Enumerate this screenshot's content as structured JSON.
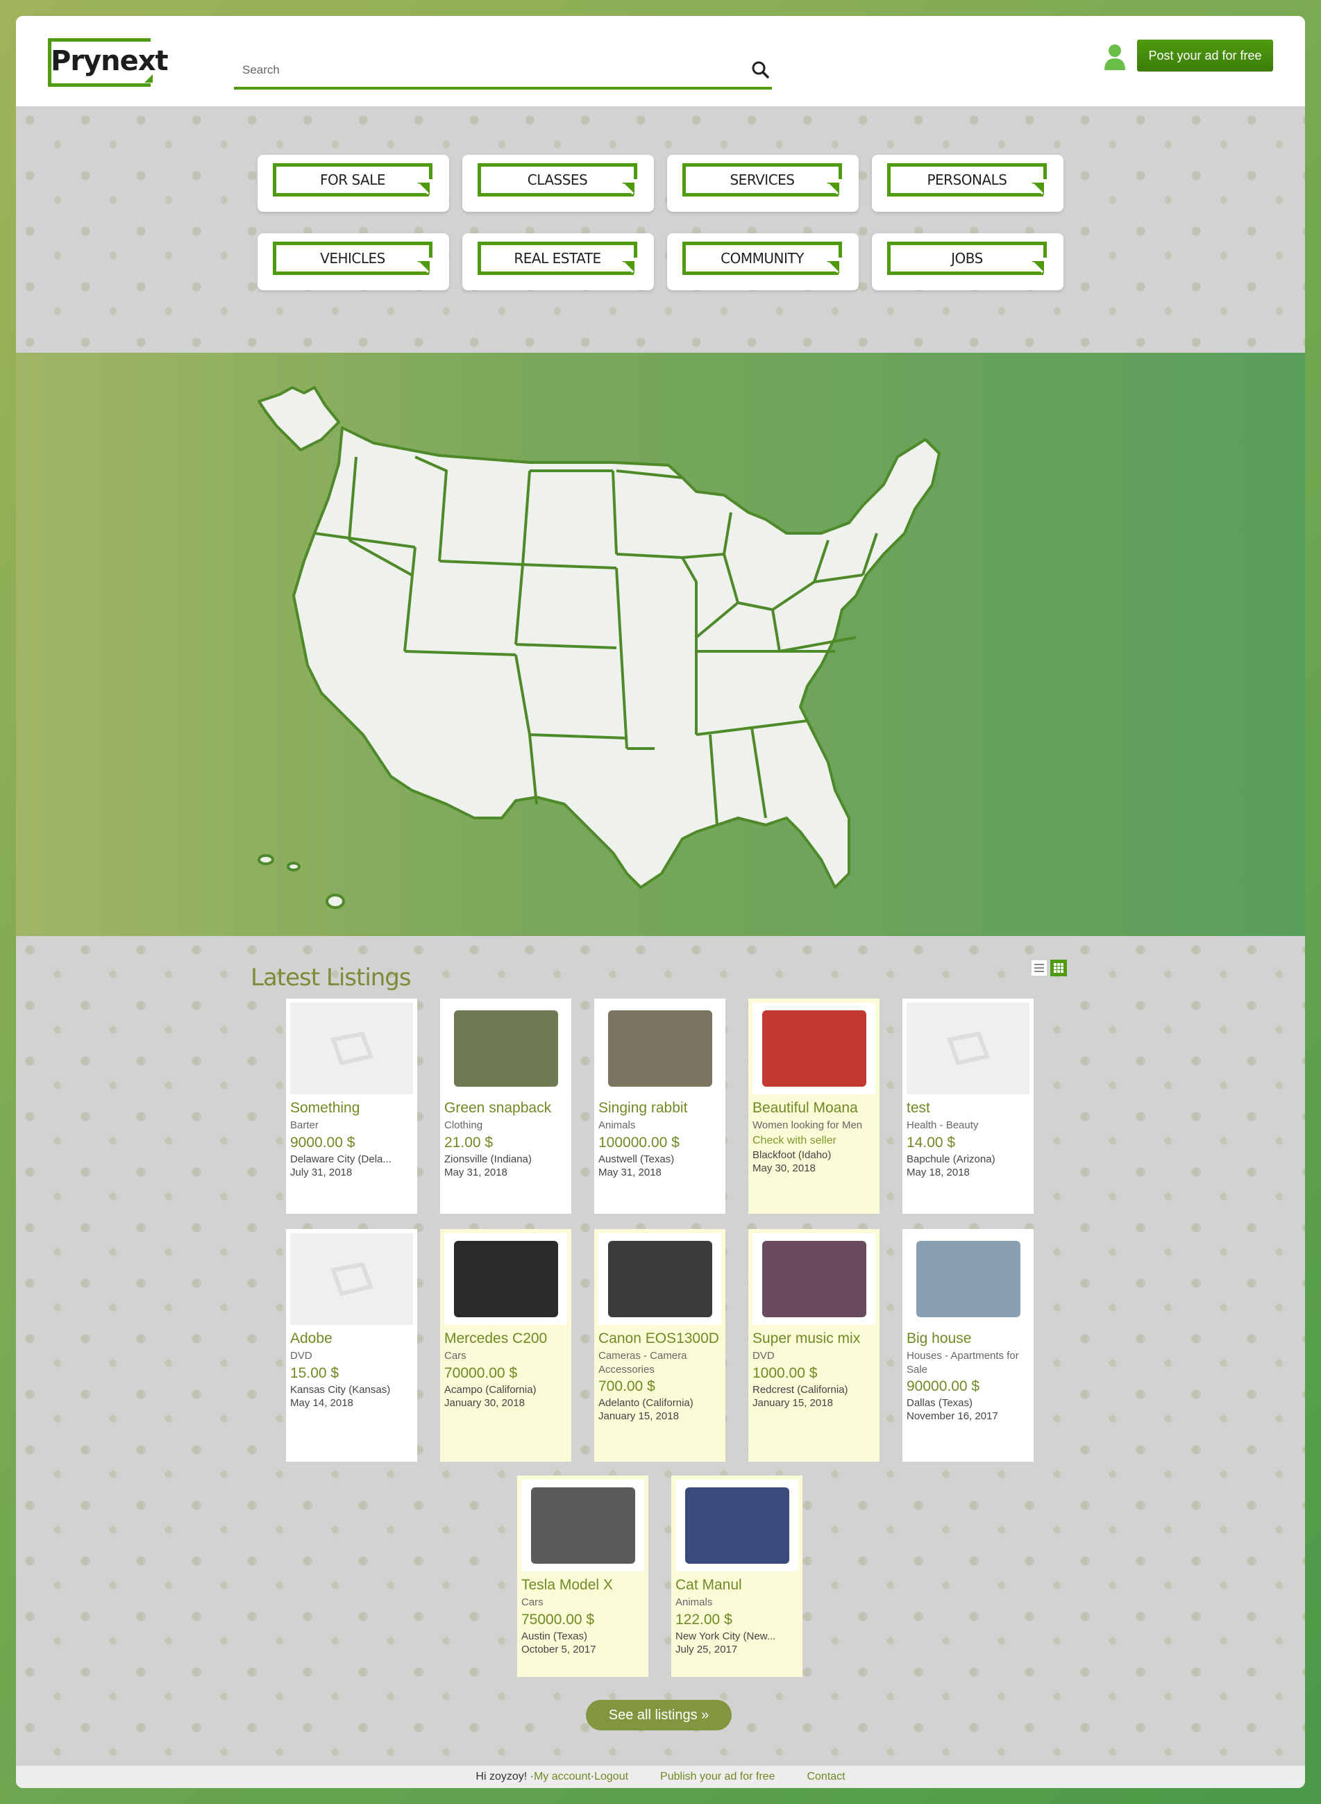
{
  "header": {
    "logo_text": "Prynext",
    "search_placeholder": "Search",
    "post_button": "Post your ad for free"
  },
  "categories": [
    "FOR SALE",
    "CLASSES",
    "SERVICES",
    "PERSONALS",
    "VEHICLES",
    "REAL ESTATE",
    "COMMUNITY",
    "JOBS"
  ],
  "listings": {
    "title": "Latest Listings",
    "items": [
      {
        "title": "Something",
        "category": "Barter",
        "price": "9000.00 $",
        "location": "Delaware City (Dela...",
        "date": "July 31, 2018",
        "premium": false
      },
      {
        "title": "Green snapback",
        "category": "Clothing",
        "price": "21.00 $",
        "location": "Zionsville (Indiana)",
        "date": "May 31, 2018",
        "premium": false
      },
      {
        "title": "Singing rabbit",
        "category": "Animals",
        "price": "100000.00 $",
        "location": "Austwell (Texas)",
        "date": "May 31, 2018",
        "premium": false
      },
      {
        "title": "Beautiful Moana",
        "category": "Women looking for Men",
        "price": "Check with seller",
        "location": "Blackfoot (Idaho)",
        "date": "May 30, 2018",
        "premium": true
      },
      {
        "title": "test",
        "category": "Health - Beauty",
        "price": "14.00 $",
        "location": "Bapchule (Arizona)",
        "date": "May 18, 2018",
        "premium": false
      },
      {
        "title": "Adobe",
        "category": "DVD",
        "price": "15.00 $",
        "location": "Kansas City (Kansas)",
        "date": "May 14, 2018",
        "premium": false
      },
      {
        "title": "Mercedes C200",
        "category": "Cars",
        "price": "70000.00 $",
        "location": "Acampo (California)",
        "date": "January 30, 2018",
        "premium": true
      },
      {
        "title": "Canon EOS1300D",
        "category": "Cameras - Camera Accessories",
        "price": "700.00 $",
        "location": "Adelanto (California)",
        "date": "January 15, 2018",
        "premium": true
      },
      {
        "title": "Super music mix",
        "category": "DVD",
        "price": "1000.00 $",
        "location": "Redcrest (California)",
        "date": "January 15, 2018",
        "premium": true
      },
      {
        "title": "Big house",
        "category": "Houses - Apartments for Sale",
        "price": "90000.00 $",
        "location": "Dallas (Texas)",
        "date": "November 16, 2017",
        "premium": false
      },
      {
        "title": "Tesla Model X",
        "category": "Cars",
        "price": "75000.00 $",
        "location": "Austin (Texas)",
        "date": "October 5, 2017",
        "premium": true
      },
      {
        "title": "Cat Manul",
        "category": "Animals",
        "price": "122.00 $",
        "location": "New York City (New...",
        "date": "July 25, 2017",
        "premium": true
      }
    ],
    "see_all": "See all listings »"
  },
  "footer": {
    "greeting": "Hi zoyzoy! · ",
    "my_account": "My account",
    "sep": " · ",
    "logout": "Logout",
    "publish": "Publish your ad for free",
    "contact": "Contact"
  },
  "colors": {
    "accent": "#4f9a0f",
    "title": "#6f8a24",
    "premium_bg": "#fbfbd8"
  }
}
